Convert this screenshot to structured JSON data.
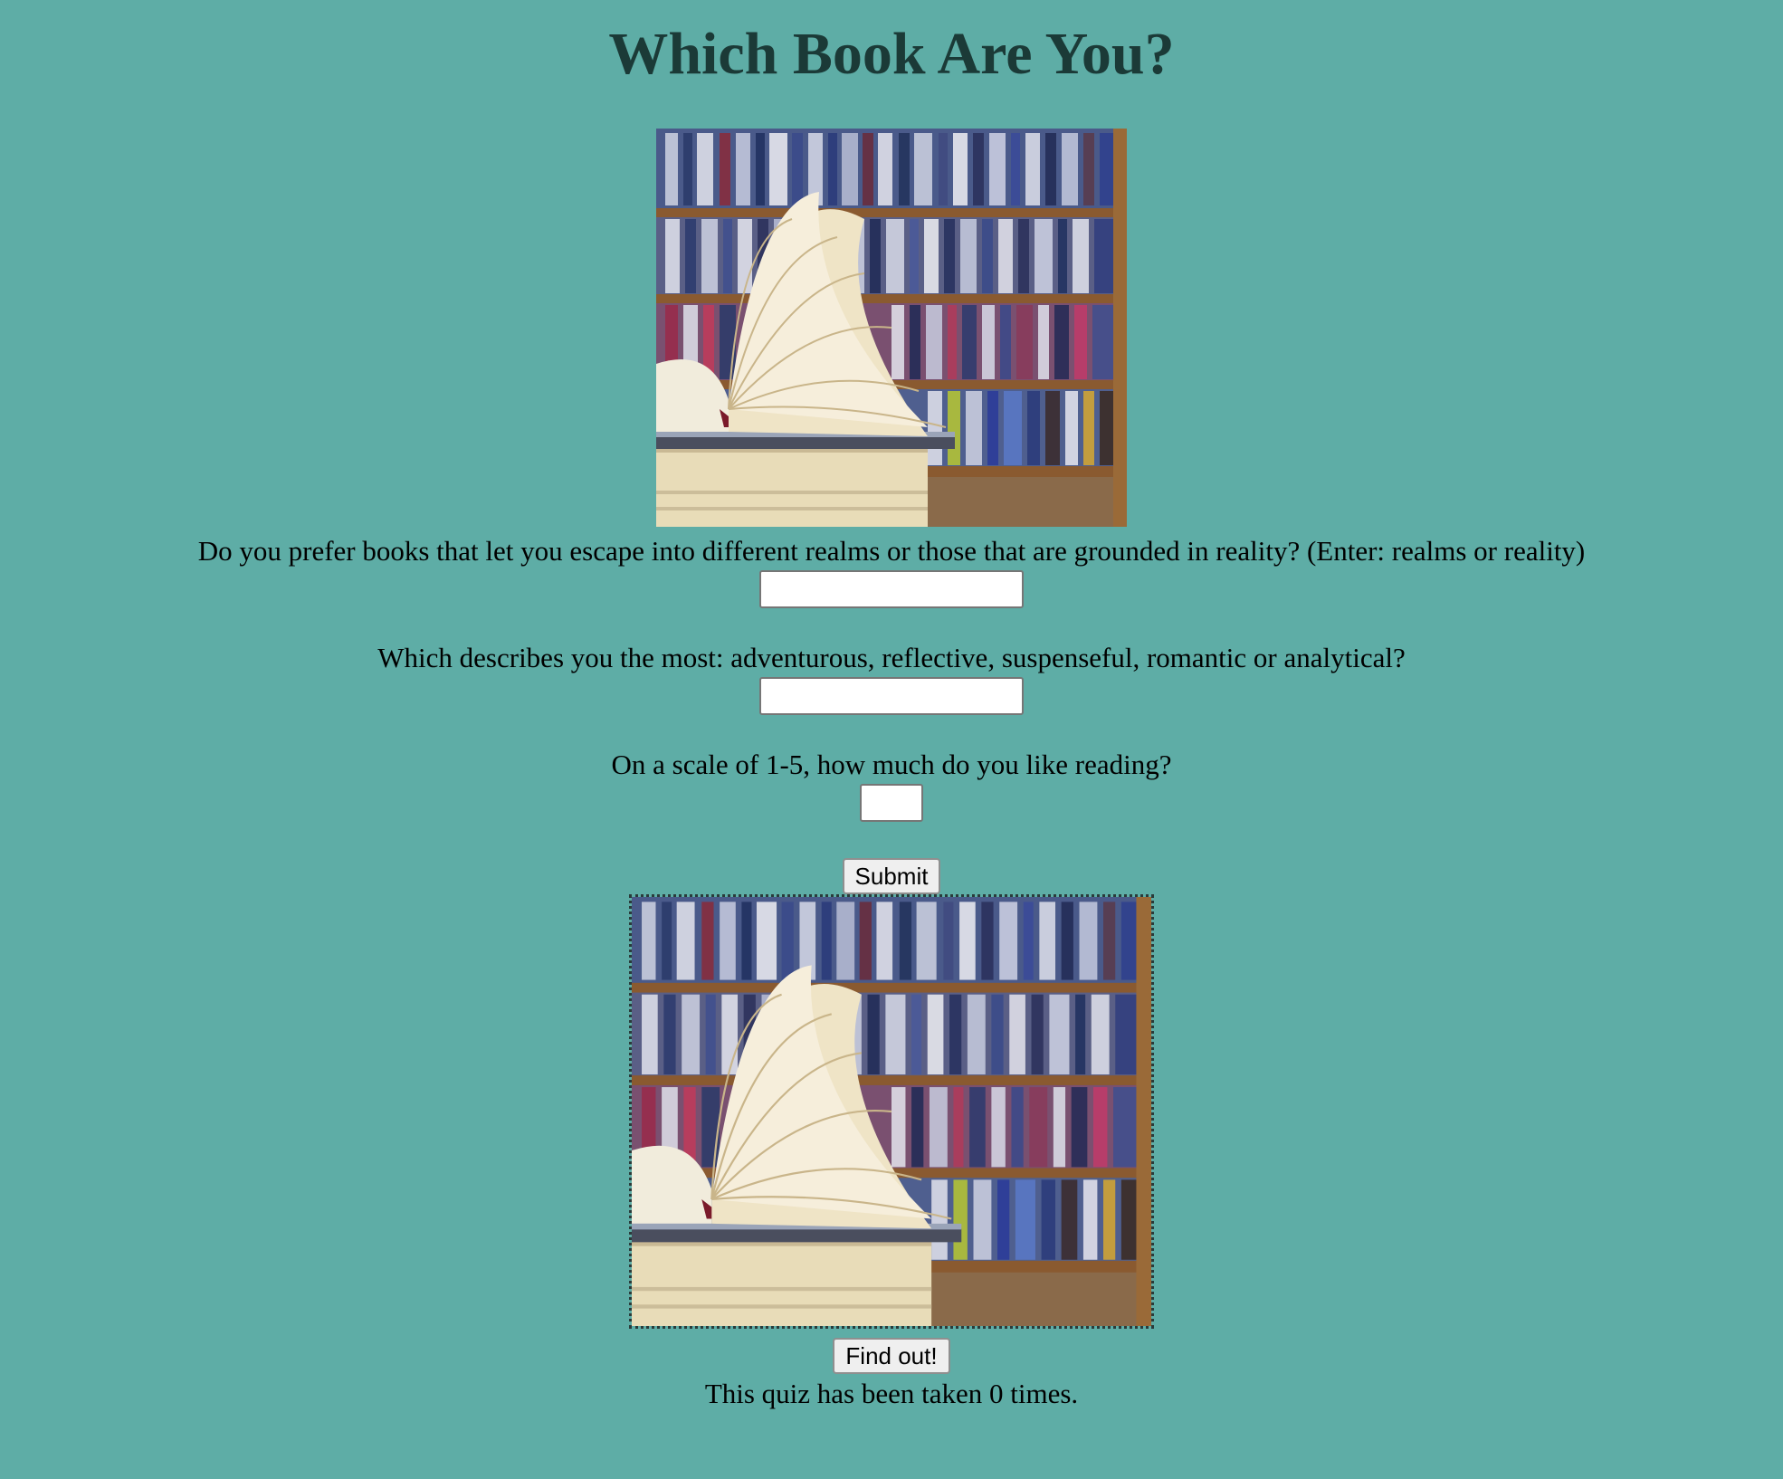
{
  "page": {
    "title": "Which Book Are You?",
    "background_color": "#5eada6",
    "title_color": "#1b3a37"
  },
  "header_image": {
    "semantic": "open-book-library-photo"
  },
  "questions": [
    {
      "label": "Do you prefer books that let you escape into different realms or those that are grounded in reality? (Enter: realms or reality)",
      "value": "",
      "placeholder": ""
    },
    {
      "label": "Which describes you the most: adventurous, reflective, suspenseful, romantic or analytical?",
      "value": "",
      "placeholder": ""
    },
    {
      "label": "On a scale of 1-5, how much do you like reading?",
      "value": "",
      "placeholder": ""
    }
  ],
  "buttons": {
    "submit_label": "Submit",
    "find_out_label": "Find out!"
  },
  "result_image": {
    "semantic": "open-book-library-photo"
  },
  "counter": {
    "text": "This quiz has been taken 0 times."
  }
}
